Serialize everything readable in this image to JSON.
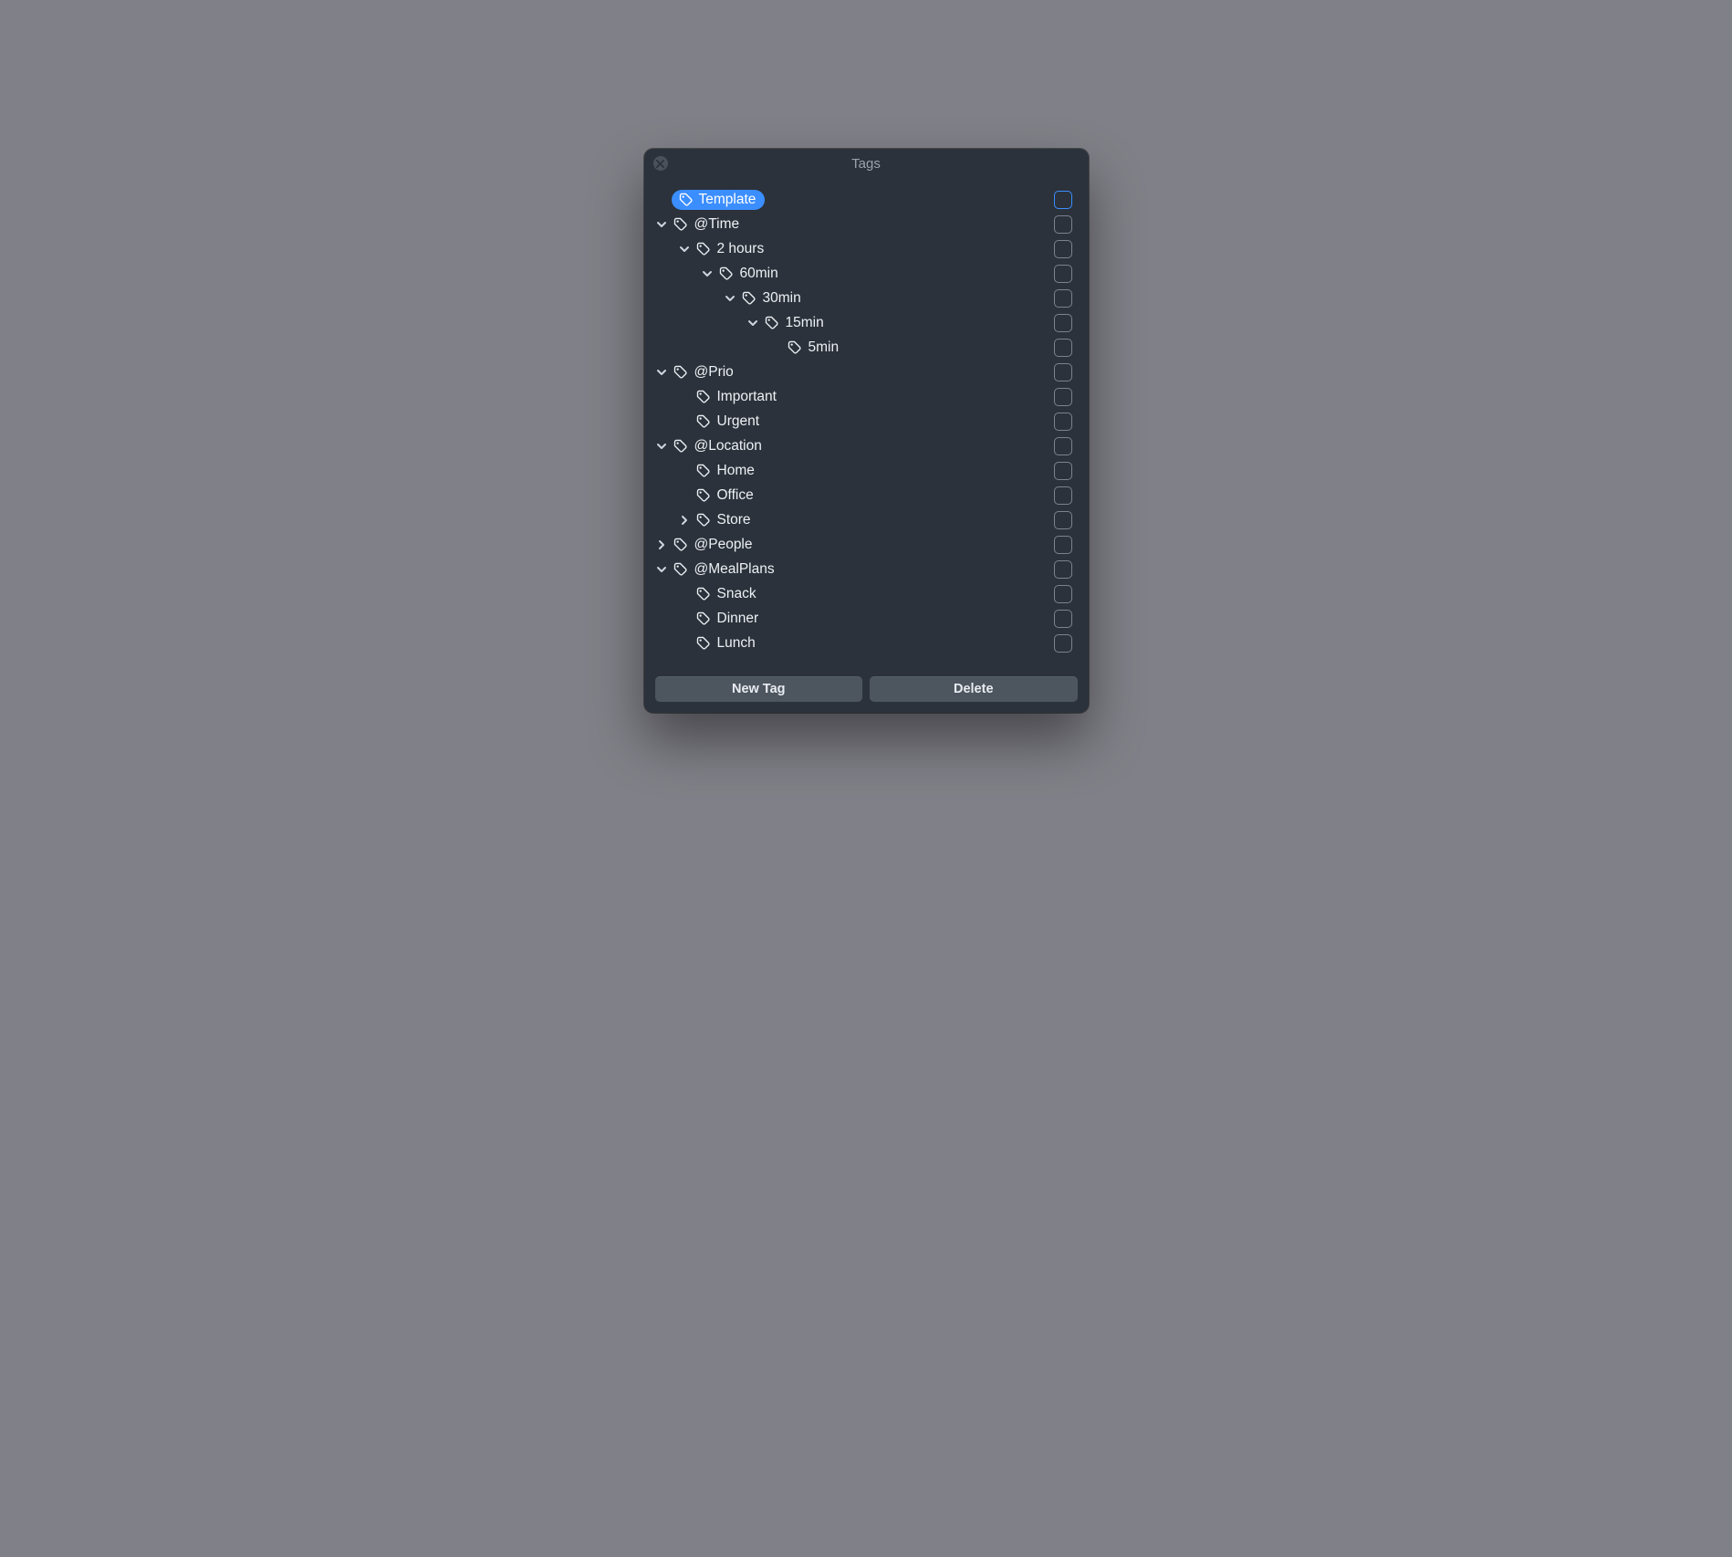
{
  "window": {
    "title": "Tags"
  },
  "buttons": {
    "new_tag": "New Tag",
    "delete": "Delete"
  },
  "tags": [
    {
      "id": "template",
      "label": "Template",
      "depth": 0,
      "disclosure": "none",
      "selected": true
    },
    {
      "id": "time",
      "label": "@Time",
      "depth": 0,
      "disclosure": "open",
      "selected": false
    },
    {
      "id": "2hours",
      "label": "2 hours",
      "depth": 1,
      "disclosure": "open",
      "selected": false
    },
    {
      "id": "60min",
      "label": "60min",
      "depth": 2,
      "disclosure": "open",
      "selected": false
    },
    {
      "id": "30min",
      "label": "30min",
      "depth": 3,
      "disclosure": "open",
      "selected": false
    },
    {
      "id": "15min",
      "label": "15min",
      "depth": 4,
      "disclosure": "open",
      "selected": false
    },
    {
      "id": "5min",
      "label": "5min",
      "depth": 5,
      "disclosure": "none",
      "selected": false
    },
    {
      "id": "prio",
      "label": "@Prio",
      "depth": 0,
      "disclosure": "open",
      "selected": false
    },
    {
      "id": "important",
      "label": "Important",
      "depth": 1,
      "disclosure": "none",
      "selected": false
    },
    {
      "id": "urgent",
      "label": "Urgent",
      "depth": 1,
      "disclosure": "none",
      "selected": false
    },
    {
      "id": "location",
      "label": "@Location",
      "depth": 0,
      "disclosure": "open",
      "selected": false
    },
    {
      "id": "home",
      "label": "Home",
      "depth": 1,
      "disclosure": "none",
      "selected": false
    },
    {
      "id": "office",
      "label": "Office",
      "depth": 1,
      "disclosure": "none",
      "selected": false
    },
    {
      "id": "store",
      "label": "Store",
      "depth": 1,
      "disclosure": "closed",
      "selected": false
    },
    {
      "id": "people",
      "label": "@People",
      "depth": 0,
      "disclosure": "closed",
      "selected": false
    },
    {
      "id": "mealplans",
      "label": "@MealPlans",
      "depth": 0,
      "disclosure": "open",
      "selected": false
    },
    {
      "id": "snack",
      "label": "Snack",
      "depth": 1,
      "disclosure": "none",
      "selected": false
    },
    {
      "id": "dinner",
      "label": "Dinner",
      "depth": 1,
      "disclosure": "none",
      "selected": false
    },
    {
      "id": "lunch",
      "label": "Lunch",
      "depth": 1,
      "disclosure": "none",
      "selected": false
    }
  ]
}
